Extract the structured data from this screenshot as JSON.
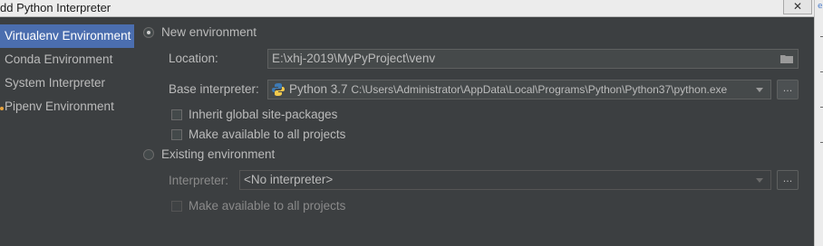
{
  "window": {
    "title": "dd Python Interpreter",
    "close_glyph": "✕"
  },
  "sidebar": {
    "items": [
      {
        "label": "Virtualenv Environment",
        "selected": true
      },
      {
        "label": "Conda Environment",
        "selected": false
      },
      {
        "label": "System Interpreter",
        "selected": false
      },
      {
        "label": "Pipenv Environment",
        "selected": false
      }
    ]
  },
  "new_env": {
    "label": "New environment",
    "selected": true,
    "location_label": "Location:",
    "location_value": "E:\\xhj-2019\\MyPyProject\\venv",
    "base_label": "Base interpreter:",
    "base_name": "Python 3.7",
    "base_path": "C:\\Users\\Administrator\\AppData\\Local\\Programs\\Python\\Python37\\python.exe",
    "inherit_label": "Inherit global site-packages",
    "make_available_label": "Make available to all projects"
  },
  "existing_env": {
    "label": "Existing environment",
    "selected": false,
    "interpreter_label": "Interpreter:",
    "interpreter_value": "<No interpreter>",
    "make_available_label": "Make available to all projects"
  },
  "buttons": {
    "browse_label": "..."
  },
  "colors": {
    "background": "#3c3f41",
    "selection": "#4b6eaf",
    "text": "#bbbbbb"
  }
}
